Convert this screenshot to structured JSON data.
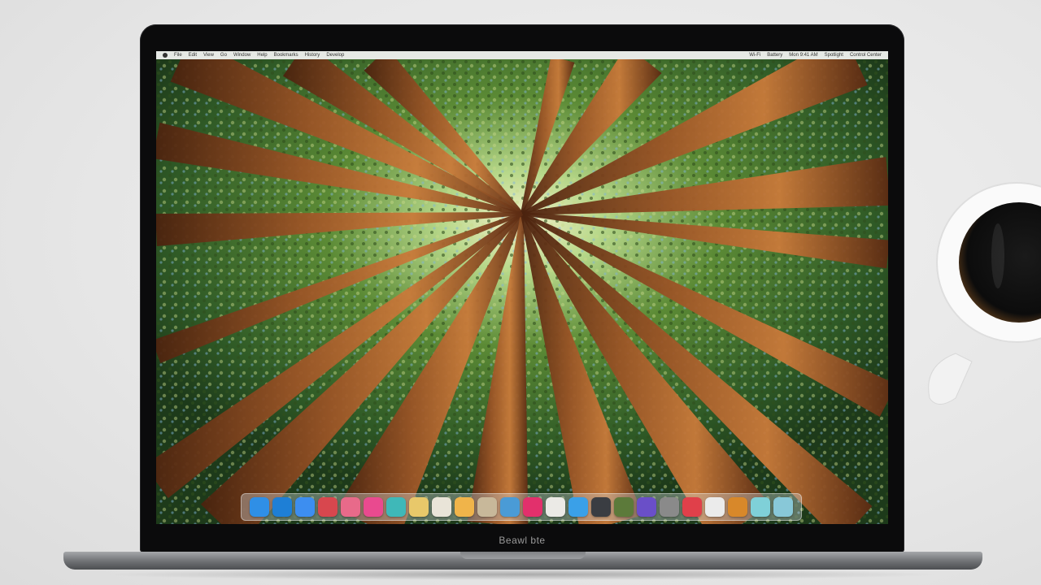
{
  "laptop": {
    "bezel_label": "Beawl bte"
  },
  "menubar": {
    "left_items": [
      "File",
      "Edit",
      "View",
      "Go",
      "Window",
      "Help",
      "Bookmarks",
      "History",
      "Develop"
    ],
    "right_items": [
      "Wi-Fi",
      "Battery",
      "Mon 9:41 AM",
      "Spotlight",
      "Control Center"
    ]
  },
  "dock": {
    "icons": [
      {
        "name": "finder-icon",
        "color": "#2f8fe6"
      },
      {
        "name": "safari-icon",
        "color": "#1e7fd6"
      },
      {
        "name": "mail-icon",
        "color": "#3d8ef0"
      },
      {
        "name": "maps-icon",
        "color": "#d8474e"
      },
      {
        "name": "photos-icon",
        "color": "#e86a8a"
      },
      {
        "name": "itunes-icon",
        "color": "#e94a8f"
      },
      {
        "name": "messages-icon",
        "color": "#3fb8b8"
      },
      {
        "name": "notes-icon",
        "color": "#e8c86a"
      },
      {
        "name": "reminders-icon",
        "color": "#e9e4d8"
      },
      {
        "name": "calendar-icon",
        "color": "#f0b44a"
      },
      {
        "name": "contacts-icon",
        "color": "#c8b89a"
      },
      {
        "name": "facetime-icon",
        "color": "#4a9bd6"
      },
      {
        "name": "music-icon",
        "color": "#e2306c"
      },
      {
        "name": "preview-icon",
        "color": "#ebeae6"
      },
      {
        "name": "appstore-icon",
        "color": "#3aa0e8"
      },
      {
        "name": "terminal-icon",
        "color": "#3a3d42"
      },
      {
        "name": "chrome-icon",
        "color": "#5c7a3a"
      },
      {
        "name": "podcasts-icon",
        "color": "#6a4fc8"
      },
      {
        "name": "tv-icon",
        "color": "#8a8a8a"
      },
      {
        "name": "news-icon",
        "color": "#e0404a"
      },
      {
        "name": "preferences-icon",
        "color": "#ebebeb"
      },
      {
        "name": "firefox-icon",
        "color": "#d8882a"
      },
      {
        "name": "downloads-icon",
        "color": "#7fd0d8"
      },
      {
        "name": "trash-icon",
        "color": "#88c8d8"
      }
    ]
  },
  "colors": {
    "wood": "#8a4a22",
    "canopy": "#4d7a2e",
    "sky": "#a9d6ee"
  }
}
